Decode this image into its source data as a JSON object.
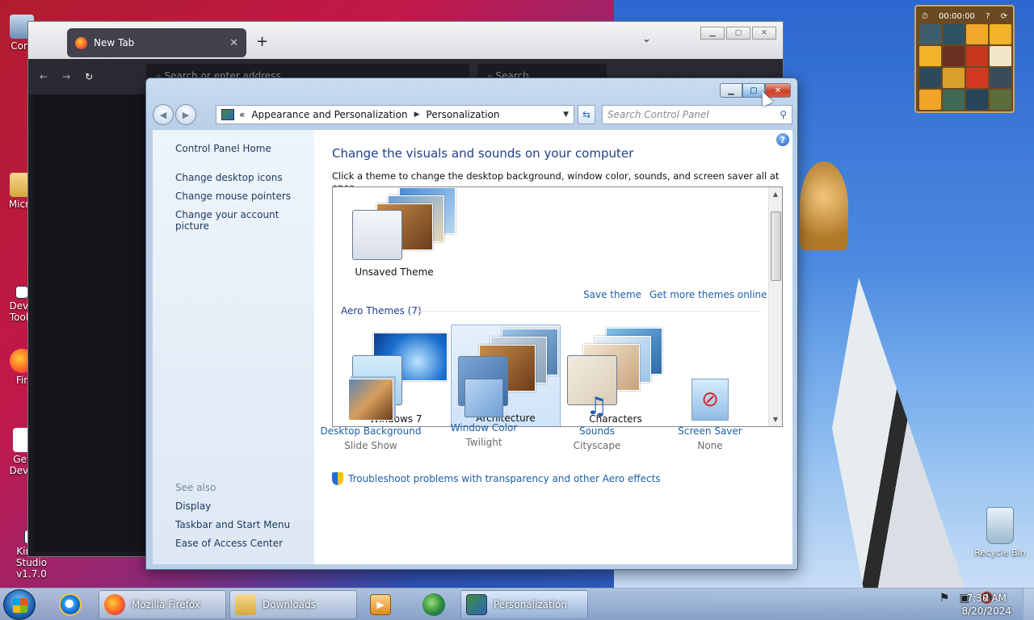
{
  "desktop": {
    "icons": [
      {
        "label": "Com"
      },
      {
        "label": "Micro"
      },
      {
        "label": "Deve Toolk"
      },
      {
        "label": "Fir"
      },
      {
        "label": "Get Deve"
      },
      {
        "label": "Kinect Studio v1.7.0"
      }
    ],
    "recycle_bin": "Recycle Bin",
    "puzzle_timer": "00:00:00"
  },
  "firefox": {
    "tab_label": "New Tab",
    "address_placeholder": "Search or enter address",
    "search_placeholder": "Search",
    "new_tab_symbol": "+",
    "tab_close_symbol": "✕"
  },
  "control_panel": {
    "breadcrumb": {
      "root": "«",
      "parent": "Appearance and Personalization",
      "current": "Personalization"
    },
    "search_placeholder": "Search Control Panel",
    "left_pane": {
      "home": "Control Panel Home",
      "tasks": [
        "Change desktop icons",
        "Change mouse pointers",
        "Change your account picture"
      ],
      "see_also_heading": "See also",
      "see_also": [
        "Display",
        "Taskbar and Start Menu",
        "Ease of Access Center"
      ]
    },
    "main": {
      "title": "Change the visuals and sounds on your computer",
      "subtitle": "Click a theme to change the desktop background, window color, sounds, and screen saver all at once.",
      "unsaved_theme": "Unsaved Theme",
      "save_theme": "Save theme",
      "get_more_themes": "Get more themes online",
      "aero_heading": "Aero Themes (7)",
      "themes": [
        {
          "label": "Windows 7",
          "selected": false
        },
        {
          "label": "Architecture",
          "selected": true
        },
        {
          "label": "Characters",
          "selected": false
        }
      ],
      "settings": [
        {
          "name": "Desktop Background",
          "value": "Slide Show"
        },
        {
          "name": "Window Color",
          "value": "Twilight"
        },
        {
          "name": "Sounds",
          "value": "Cityscape"
        },
        {
          "name": "Screen Saver",
          "value": "None"
        }
      ],
      "troubleshoot": "Troubleshoot problems with transparency and other Aero effects"
    }
  },
  "taskbar": {
    "items": [
      {
        "label": "Mozilla Firefox"
      },
      {
        "label": "Downloads"
      },
      {
        "label": "Personalization"
      }
    ],
    "clock_time": "7:30 AM",
    "clock_date": "8/20/2024"
  },
  "colors": {
    "link": "#1c5fa8",
    "heading": "#1e3e8c",
    "selection": "#cfe3f8"
  }
}
